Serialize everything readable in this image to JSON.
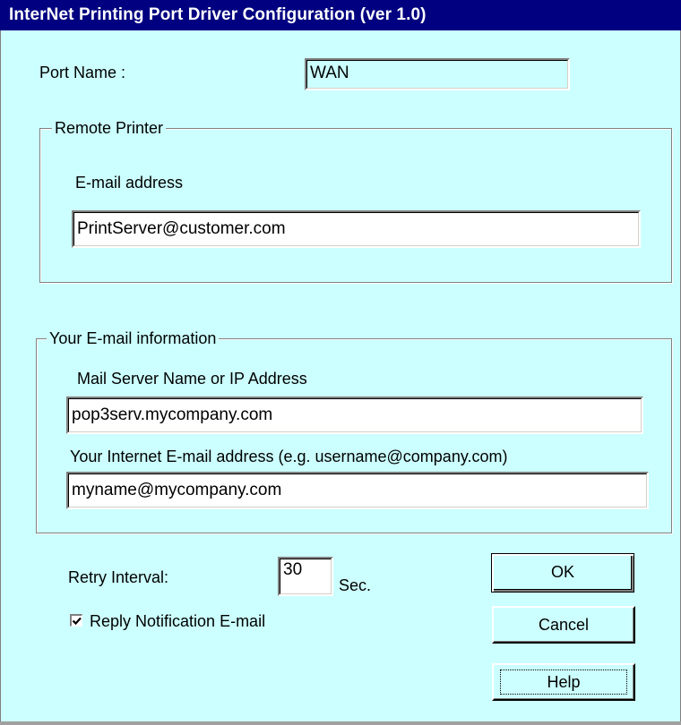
{
  "window": {
    "title": "InterNet Printing Port Driver Configuration  (ver 1.0)"
  },
  "port": {
    "label": "Port Name :",
    "value": "WAN"
  },
  "remote_printer": {
    "group_label": "Remote Printer",
    "email_label": "E-mail address",
    "email_value": "PrintServer@customer.com"
  },
  "your_email": {
    "group_label": "Your E-mail information",
    "server_label": "Mail Server Name or IP Address",
    "server_value": "pop3serv.mycompany.com",
    "address_label": "Your Internet E-mail address (e.g. username@company.com)",
    "address_value": "myname@mycompany.com"
  },
  "retry": {
    "label": "Retry Interval:",
    "value": "30",
    "unit": "Sec."
  },
  "reply_notification": {
    "label": "Reply Notification E-mail",
    "checked": true
  },
  "buttons": {
    "ok": "OK",
    "cancel": "Cancel",
    "help": "Help"
  }
}
